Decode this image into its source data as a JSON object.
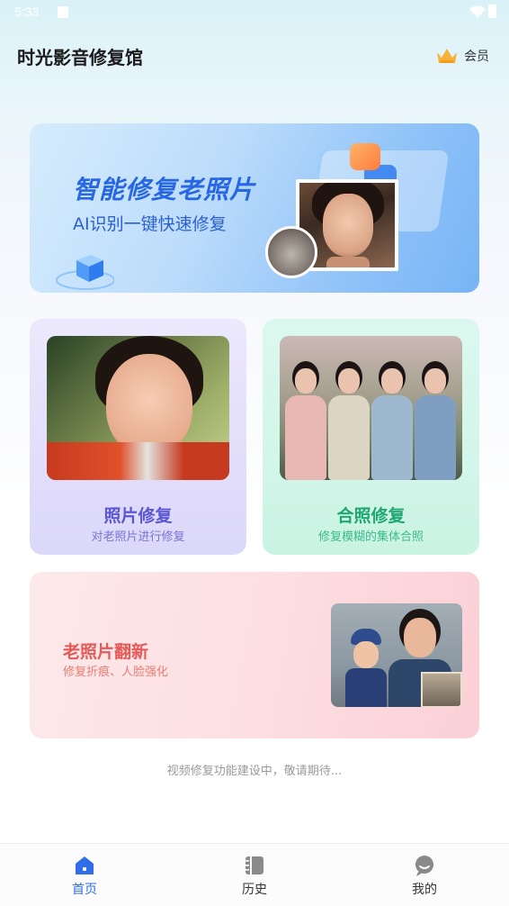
{
  "status_bar": {
    "time": "5:33"
  },
  "header": {
    "title": "时光影音修复馆",
    "member_label": "会员"
  },
  "hero": {
    "title": "智能修复老照片",
    "subtitle": "AI识别一键快速修复"
  },
  "cards": {
    "photo_repair": {
      "title": "照片修复",
      "subtitle": "对老照片进行修复"
    },
    "group_repair": {
      "title": "合照修复",
      "subtitle": "修复模糊的集体合照"
    },
    "renovate": {
      "title": "老照片翻新",
      "subtitle": "修复折痕、人脸强化"
    }
  },
  "footer_note": "视频修复功能建设中，敬请期待...",
  "tabs": [
    {
      "label": "首页",
      "active": true
    },
    {
      "label": "历史",
      "active": false
    },
    {
      "label": "我的",
      "active": false
    }
  ],
  "colors": {
    "accent": "#2f6ee6",
    "photo_repair": "#5b56d6",
    "group_repair": "#1fa774",
    "renovate": "#e55a57"
  }
}
